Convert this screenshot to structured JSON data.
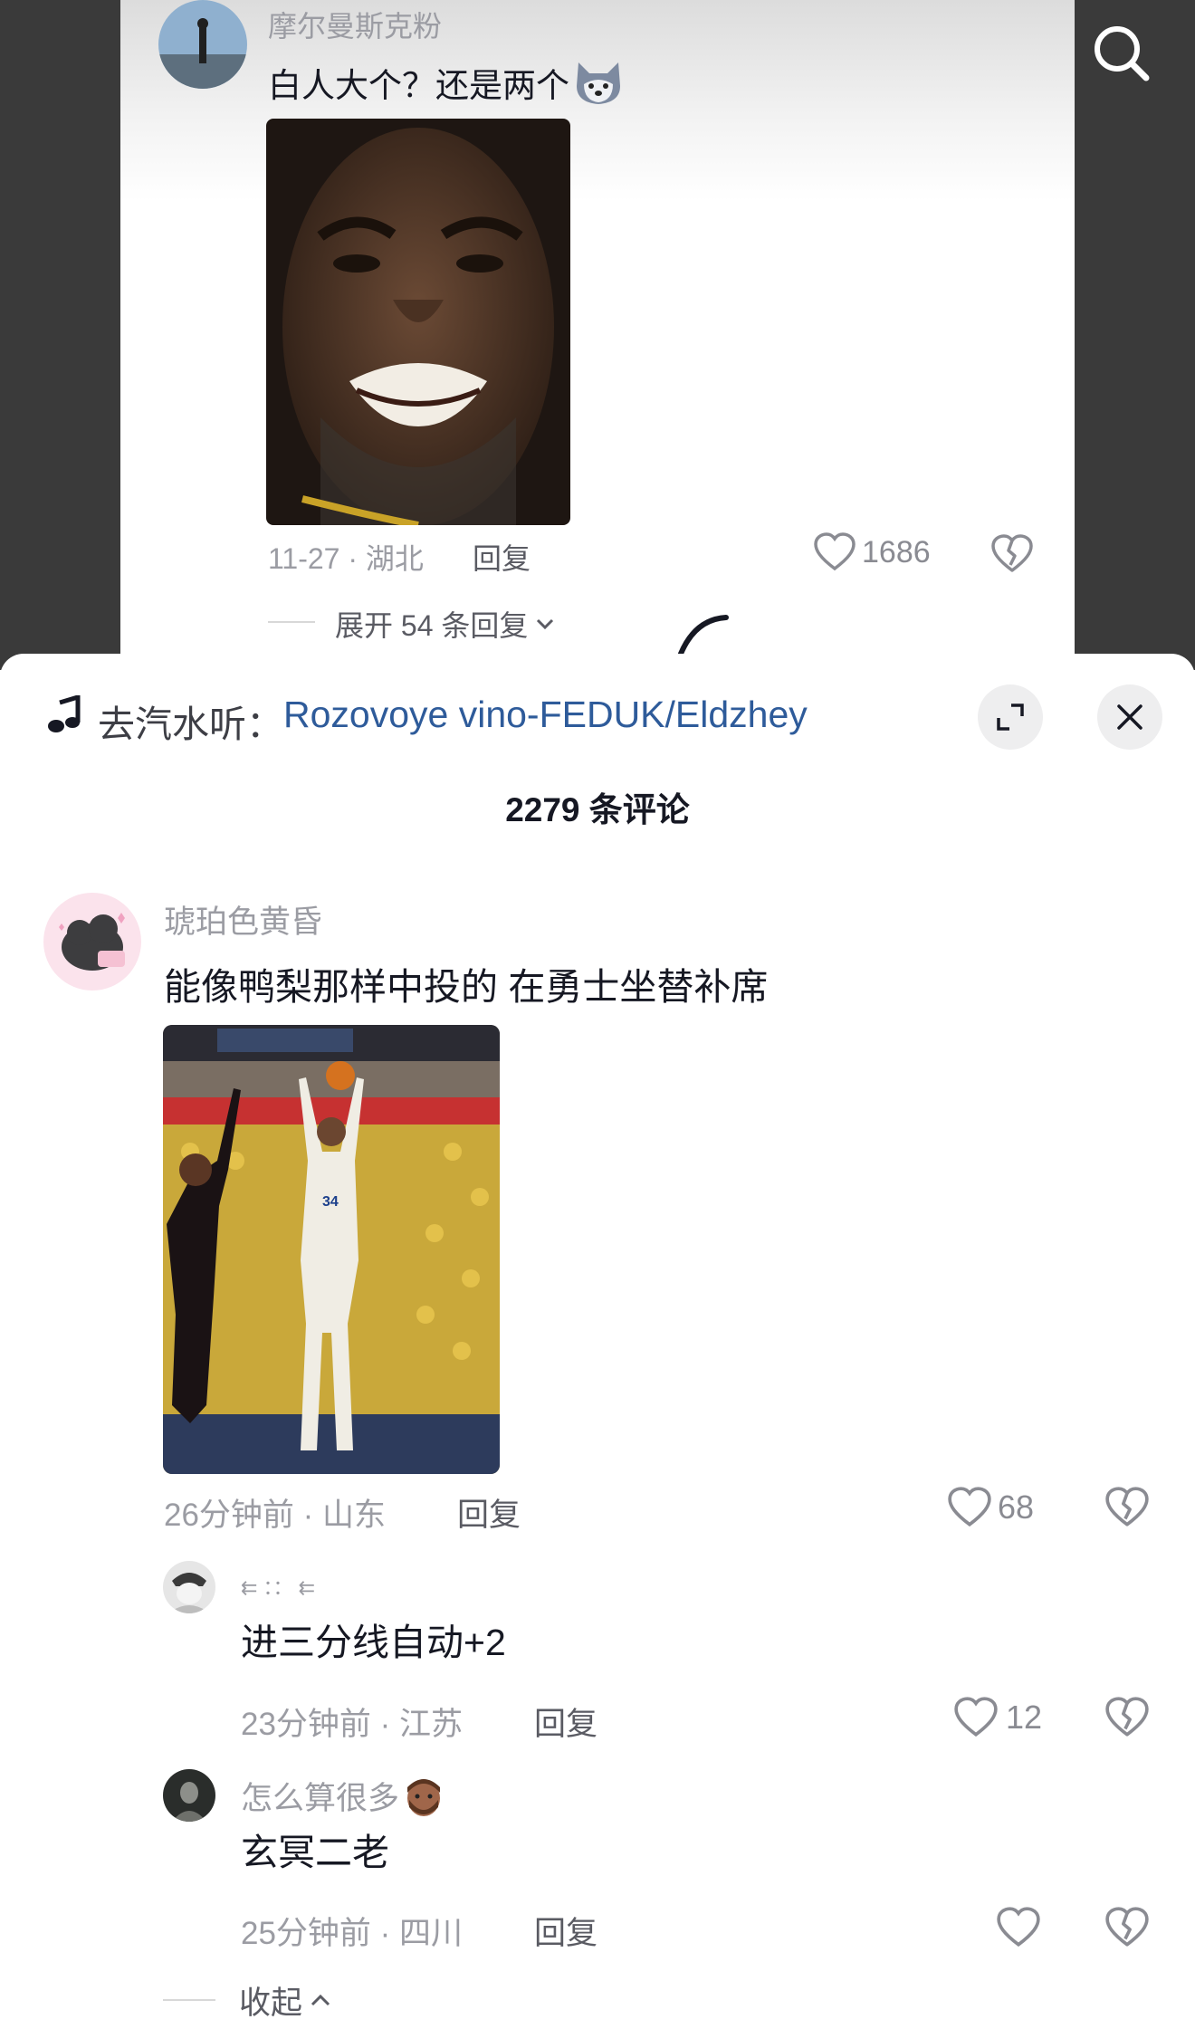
{
  "top_comment": {
    "username": "摩尔曼斯克粉",
    "text": "白人大个？还是两个",
    "emoji": "husky-emoji",
    "meta": "11-27 · 湖北",
    "reply_label": "回复",
    "likes": "1686",
    "expand_label": "展开 54 条回复"
  },
  "panel": {
    "music_prefix": "去汽水听：",
    "music_title": "Rozovoye vino-FEDUK/Eldzhey",
    "comment_count": "2279 条评论"
  },
  "comments": [
    {
      "username": "琥珀色黄昏",
      "text": "能像鸭梨那样中投的 在勇士坐替补席",
      "meta": "26分钟前 · 山东",
      "reply_label": "回复",
      "likes": "68"
    }
  ],
  "replies": [
    {
      "username": "⇇ ：：  ⇇",
      "text": "进三分线自动+2",
      "meta": "23分钟前 · 江苏",
      "reply_label": "回复",
      "likes": "12"
    },
    {
      "username": "怎么算很多",
      "text": "玄冥二老",
      "meta": "25分钟前 · 四川",
      "reply_label": "回复",
      "likes": ""
    }
  ],
  "collapse_label": "收起",
  "colors": {
    "link": "#2e5b9a",
    "muted": "#9b9ca3",
    "text": "#161823",
    "panel_bg": "#ffffff",
    "backdrop": "#3a3a3a"
  }
}
